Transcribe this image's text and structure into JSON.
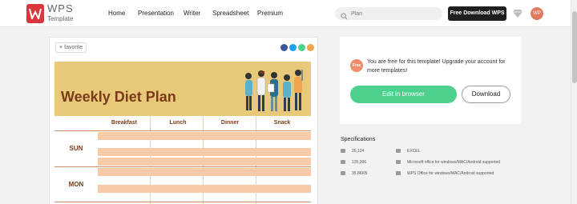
{
  "header": {
    "logo_text": "WPS",
    "logo_sub": "Template",
    "nav": [
      "Home",
      "Presentation",
      "Writer",
      "Spreadsheet",
      "Premium"
    ],
    "search_placeholder": "Plan",
    "download_label": "Free Download WPS",
    "avatar_initials": "WP"
  },
  "preview": {
    "favorite_label": "favorite",
    "banner_title": "Weekly Diet Plan",
    "columns": [
      "Breakfast",
      "Lunch",
      "Dinner",
      "Snack"
    ],
    "days": [
      "SUN",
      "MON"
    ],
    "share_colors": [
      "#3b5998",
      "#1da1f2",
      "#4cd08c",
      "#f0a64c"
    ],
    "banner_color": "#e8c97a",
    "stripe_color": "#f8cba8"
  },
  "offer": {
    "badge": "Free",
    "text": "You are free for this template! Upgrade your account for more templates!",
    "edit_label": "Edit in browser",
    "download_label": "Download",
    "accent": "#4cd08c"
  },
  "specs": {
    "title": "Specifications",
    "items": [
      {
        "icon": "download-count-icon",
        "value": "26,124"
      },
      {
        "icon": "excel-icon",
        "value": "EXCEL"
      },
      {
        "icon": "views-icon",
        "value": "135,006"
      },
      {
        "icon": "platform-icon",
        "value": "Microsoft office for windows/MAC/Android supported"
      },
      {
        "icon": "filesize-icon",
        "value": "35.86KB"
      },
      {
        "icon": "platform-icon",
        "value": "WPS Office for windows/MAC/Android supported"
      }
    ]
  }
}
